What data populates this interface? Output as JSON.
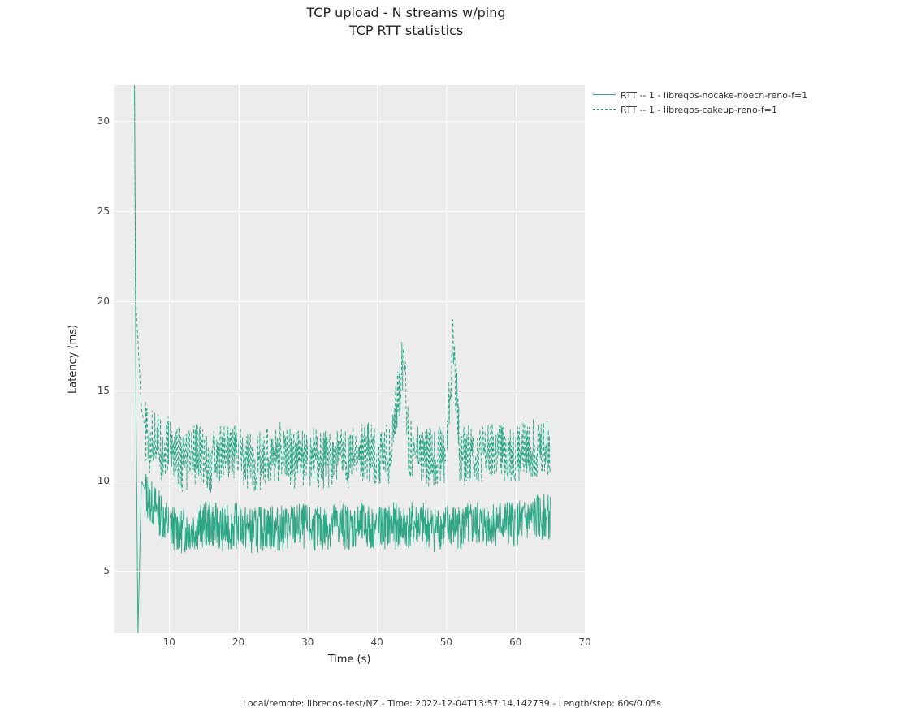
{
  "title_line1": "TCP upload - N streams w/ping",
  "title_line2": "TCP RTT statistics",
  "xlabel": "Time (s)",
  "ylabel": "Latency (ms)",
  "footer": "Local/remote: libreqos-test/NZ - Time: 2022-12-04T13:57:14.142739 - Length/step: 60s/0.05s",
  "legend": {
    "items": [
      {
        "label": "RTT -- 1 - libreqos-nocake-noecn-reno-f=1",
        "style": "solid"
      },
      {
        "label": "RTT -- 1 - libreqos-cakeup-reno-f=1",
        "style": "dashed"
      }
    ]
  },
  "x_ticks": [
    10,
    20,
    30,
    40,
    50,
    60,
    70
  ],
  "y_ticks": [
    5,
    10,
    15,
    20,
    25,
    30
  ],
  "chart_data": {
    "type": "line",
    "xlabel": "Time (s)",
    "ylabel": "Latency (ms)",
    "xlim": [
      2,
      70
    ],
    "ylim": [
      1.5,
      32
    ],
    "grid": true,
    "legend_position": "upper right (outside axes)",
    "series": [
      {
        "name": "RTT -- 1 - libreqos-nocake-noecn-reno-f=1",
        "style": "solid",
        "color": "#2ca887",
        "note": "Very dense noisy timeseries (~1200 points over 5s→65s). Values below are representative samples at ~1s spacing; actual trace oscillates rapidly between roughly 5.5ms and 9ms after initial spike.",
        "x": [
          5,
          5.2,
          5.5,
          6,
          7,
          8,
          9,
          10,
          12,
          14,
          16,
          18,
          20,
          22,
          24,
          26,
          28,
          30,
          32,
          34,
          36,
          38,
          40,
          42,
          44,
          46,
          48,
          50,
          52,
          54,
          56,
          58,
          60,
          62,
          64,
          65
        ],
        "y": [
          32,
          15,
          1.5,
          10,
          9,
          8.5,
          8,
          7.5,
          7.2,
          7.4,
          7.6,
          7.3,
          7.5,
          7.2,
          7.4,
          7.3,
          7.5,
          7.4,
          7.3,
          7.6,
          7.4,
          7.5,
          7.3,
          7.5,
          7.4,
          7.6,
          7.3,
          7.5,
          7.4,
          7.5,
          7.6,
          7.7,
          7.5,
          7.8,
          8.0,
          7.9
        ]
      },
      {
        "name": "RTT -- 1 - libreqos-cakeup-reno-f=1",
        "style": "dashed",
        "color": "#2ca887",
        "note": "Very dense noisy dashed timeseries (~1200 points over 5s→65s). Values below are representative samples at ~1s spacing; actual trace oscillates rapidly between roughly 8ms and 13ms after initial spike, with occasional peaks to ~14ms and two spikes near t≈44s (≈17ms) and t≈51s (≈18ms).",
        "x": [
          5,
          5.2,
          6,
          7,
          8,
          9,
          10,
          12,
          14,
          16,
          18,
          20,
          22,
          24,
          26,
          28,
          30,
          32,
          34,
          36,
          38,
          40,
          42,
          44,
          44.5,
          46,
          48,
          50,
          51,
          52,
          54,
          56,
          58,
          60,
          62,
          64,
          65
        ],
        "y": [
          32,
          20,
          14,
          12,
          12.5,
          11.5,
          12,
          11,
          11.5,
          11,
          12,
          11.5,
          11,
          11.3,
          11.6,
          11.2,
          11.4,
          11,
          11.5,
          11.2,
          11.7,
          11.3,
          11.5,
          17.4,
          12,
          11.4,
          11.2,
          11.5,
          17.9,
          11.3,
          11.6,
          11.4,
          11.7,
          11.5,
          11.8,
          12,
          11.6
        ]
      }
    ]
  }
}
